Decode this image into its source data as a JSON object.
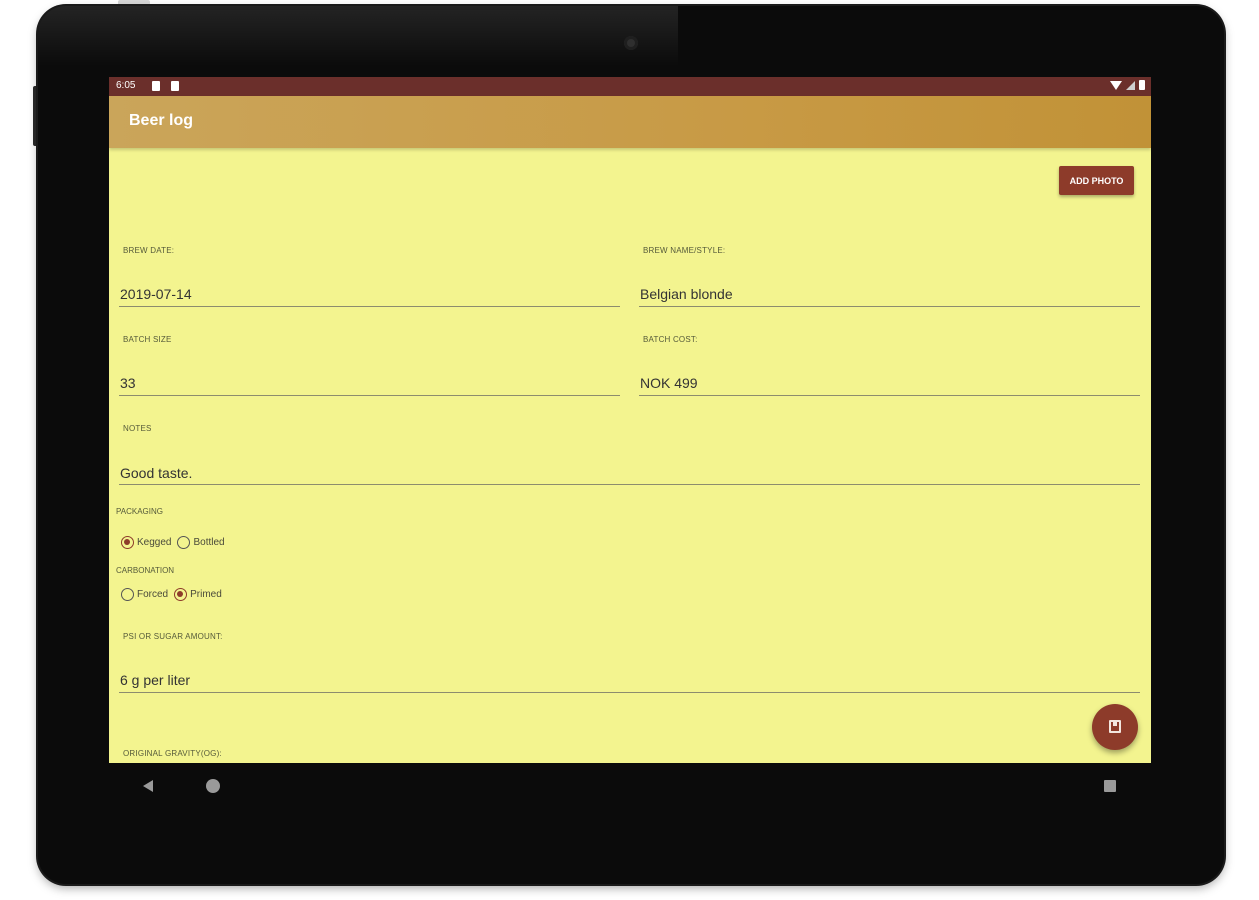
{
  "status_bar": {
    "time": "6:05"
  },
  "app_bar": {
    "title": "Beer log"
  },
  "actions": {
    "add_photo": "ADD PHOTO"
  },
  "fields": {
    "brew_date": {
      "label": "BREW DATE:",
      "value": "2019-07-14"
    },
    "brew_name": {
      "label": "BREW NAME/STYLE:",
      "value": "Belgian blonde"
    },
    "batch_size": {
      "label": "BATCH SIZE",
      "value": "33"
    },
    "batch_cost": {
      "label": "BATCH COST:",
      "value": "NOK 499"
    },
    "notes": {
      "label": "NOTES",
      "value": "Good taste."
    },
    "sugar_amount": {
      "label": "PSI OR SUGAR AMOUNT:",
      "value": "6 g per liter"
    },
    "original_gravity": {
      "label": "ORIGINAL GRAVITY(OG):"
    }
  },
  "packaging": {
    "label": "PACKAGING",
    "options": [
      {
        "label": "Kegged",
        "selected": true
      },
      {
        "label": "Bottled",
        "selected": false
      }
    ]
  },
  "carbonation": {
    "label": "CARBONATION",
    "options": [
      {
        "label": "Forced",
        "selected": false
      },
      {
        "label": "Primed",
        "selected": true
      }
    ]
  },
  "colors": {
    "screen_background": "#f3f48f",
    "app_bar": "#c89a45",
    "accent": "#8d3b2a",
    "status_bar": "#6b2f2b"
  },
  "icons": {
    "fab": "save-icon",
    "nav": [
      "back-icon",
      "home-icon",
      "recents-icon"
    ]
  }
}
